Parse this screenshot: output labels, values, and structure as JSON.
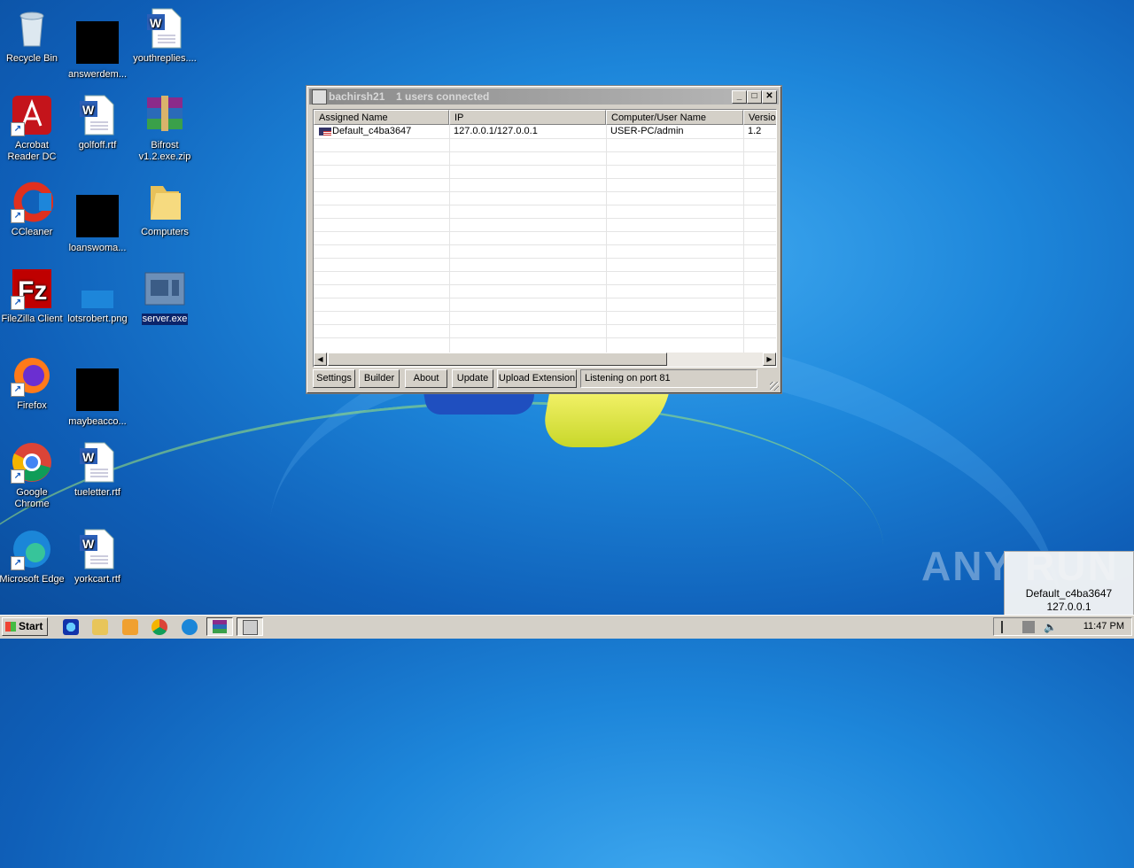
{
  "desktop": {
    "icons": [
      {
        "label": "Recycle Bin"
      },
      {
        "label": "answerdem..."
      },
      {
        "label": "youthreplies...."
      },
      {
        "label": "Acrobat Reader DC"
      },
      {
        "label": "golfoff.rtf"
      },
      {
        "label": "Bifrost v1.2.exe.zip"
      },
      {
        "label": "CCleaner"
      },
      {
        "label": "loanswoma..."
      },
      {
        "label": "Computers"
      },
      {
        "label": "FileZilla Client"
      },
      {
        "label": "lotsrobert.png"
      },
      {
        "label": "server.exe"
      },
      {
        "label": "Firefox"
      },
      {
        "label": "maybeacco..."
      },
      {
        "label": "Google Chrome"
      },
      {
        "label": "tueletter.rtf"
      },
      {
        "label": "Microsoft Edge"
      },
      {
        "label": "yorkcart.rtf"
      }
    ]
  },
  "window": {
    "title": "bachirsh21",
    "status": "1 users connected",
    "columns": [
      "Assigned Name",
      "IP",
      "Computer/User Name",
      "Versio"
    ],
    "rows": [
      {
        "name": "Default_c4ba3647",
        "ip": "127.0.0.1/127.0.0.1",
        "user": "USER-PC/admin",
        "version": "1.2"
      }
    ],
    "buttons": {
      "settings": "Settings",
      "builder": "Builder",
      "about": "About",
      "update": "Update",
      "upload": "Upload Extension"
    },
    "statusbar": "Listening on port 81"
  },
  "watermark": "ANY RUN",
  "notification": {
    "line1": "Default_c4ba3647",
    "line2": "127.0.0.1"
  },
  "taskbar": {
    "start": "Start",
    "clock": "11:47 PM"
  }
}
